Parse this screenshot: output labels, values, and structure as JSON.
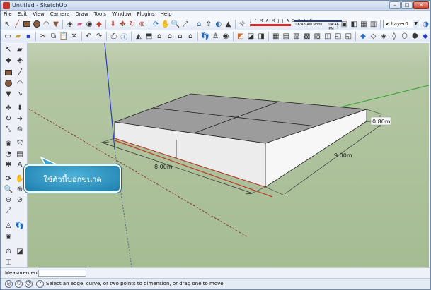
{
  "window": {
    "title": "Untitled - SketchUp"
  },
  "menu": [
    "File",
    "Edit",
    "View",
    "Camera",
    "Draw",
    "Tools",
    "Window",
    "Plugins",
    "Help"
  ],
  "layer": {
    "selected": "Layer0"
  },
  "shadow": {
    "months": "J F M A M J J A S O N D",
    "time_start": "06:43 AM",
    "time_mid": "Noon",
    "time_end": "04:46 PM"
  },
  "model": {
    "dim_width": "8.00m",
    "dim_depth": "9.00m",
    "dim_height": "0.80m"
  },
  "callout": {
    "text": "ใช้ตัวนี้บอกขนาด"
  },
  "measurements": {
    "label": "Measurements",
    "value": ""
  },
  "status": {
    "text": "Select an edge, curve, or two points to dimension, or drag one to move."
  },
  "colors": {
    "axis_red": "#c0392b",
    "axis_green": "#2ea12e",
    "axis_blue": "#2b3fbf",
    "box_top": "#9a9a9a",
    "box_side": "#ececec",
    "callout": "#2a8fc3"
  }
}
